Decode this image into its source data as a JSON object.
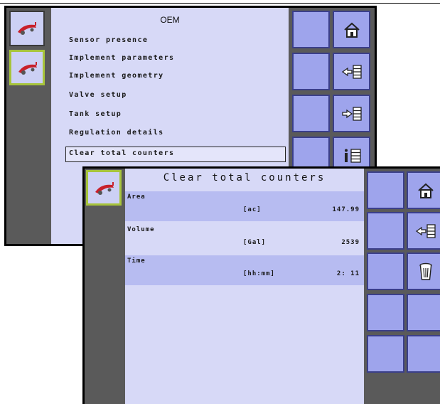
{
  "screen_oem": {
    "title": "OEM",
    "menu": [
      "Sensor presence",
      "Implement parameters",
      "Implement geometry",
      "Valve setup",
      "Tank setup",
      "Regulation details",
      "Clear total counters"
    ],
    "selected_index": 6,
    "buttons": [
      "home-icon",
      "back-list-icon",
      "forward-list-icon",
      "info-list-icon"
    ]
  },
  "screen_clear": {
    "title": "Clear total counters",
    "rows": [
      {
        "label": "Area",
        "unit": "[ac]",
        "value": "147.99"
      },
      {
        "label": "Volume",
        "unit": "[Gal]",
        "value": "2539"
      },
      {
        "label": "Time",
        "unit": "[hh:mm]",
        "value": "2: 11"
      }
    ],
    "buttons": [
      "home-icon",
      "back-list-icon",
      "trash-icon"
    ]
  },
  "colors": {
    "panel_bg": "#5a5a5a",
    "content_bg": "#d7d9f7",
    "button_bg": "#9ea4ec",
    "row_shaded": "#b7bcf1",
    "active_border": "#a7c43b"
  }
}
